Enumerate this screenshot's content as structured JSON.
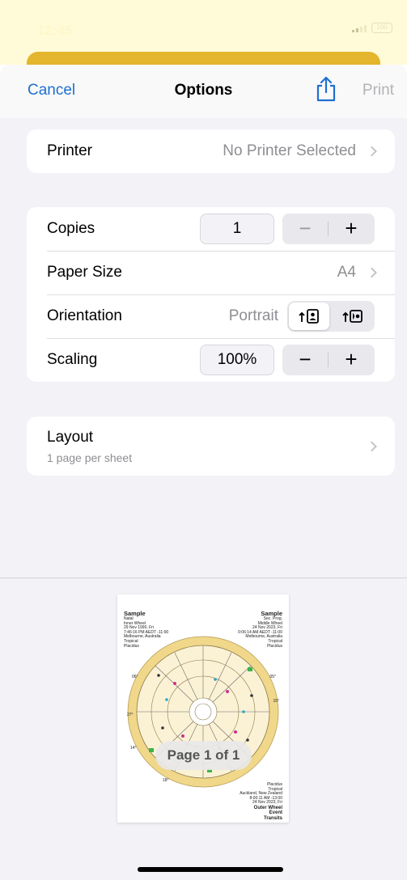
{
  "status": {
    "time": "12:45",
    "battery": "100"
  },
  "nav": {
    "cancel": "Cancel",
    "title": "Options",
    "print": "Print"
  },
  "printer": {
    "label": "Printer",
    "value": "No Printer Selected"
  },
  "settings": {
    "copies": {
      "label": "Copies",
      "value": "1",
      "minus": "−",
      "plus": "+"
    },
    "paper_size": {
      "label": "Paper Size",
      "value": "A4"
    },
    "orientation": {
      "label": "Orientation",
      "value": "Portrait",
      "options": [
        "portrait-icon",
        "landscape-icon"
      ],
      "selected": "portrait"
    },
    "scaling": {
      "label": "Scaling",
      "value": "100%",
      "minus": "−",
      "plus": "+"
    }
  },
  "layout": {
    "label": "Layout",
    "sublabel": "1 page per sheet"
  },
  "preview": {
    "page_indicator": "Page 1 of 1",
    "left_block": {
      "name": "Sample",
      "lines": [
        "Natal",
        "Inner Wheel",
        "29 Nov 1990, Fri",
        "7:46:16 PM AEDT -11:00",
        "Melbourne, Australia",
        "Tropical",
        "Placidus"
      ]
    },
    "right_block": {
      "name": "Sample",
      "lines": [
        "Sec. Prog.",
        "Middle Wheel",
        "24 Nov 2023, Fri",
        "0:06:14 AM AEDT -11:00",
        "Melbourne, Australia",
        "Tropical",
        "Placidus"
      ]
    },
    "bottom_right": {
      "lines": [
        "Placidus",
        "Tropical",
        "Auckland, New Zealand",
        "8:00:11 AM -13:00",
        "24 Nov 2023, Fri"
      ],
      "bold_lines": [
        "Outer Wheel",
        "Event",
        "Transits"
      ]
    },
    "wheel_degrees": [
      "06°",
      "27°",
      "14°",
      "15°",
      "05°",
      "18°"
    ],
    "colors": {
      "wheel_ring": "#f0d78a",
      "wheel_fill": "#fbf2d6",
      "line": "#6a6a6a"
    }
  }
}
